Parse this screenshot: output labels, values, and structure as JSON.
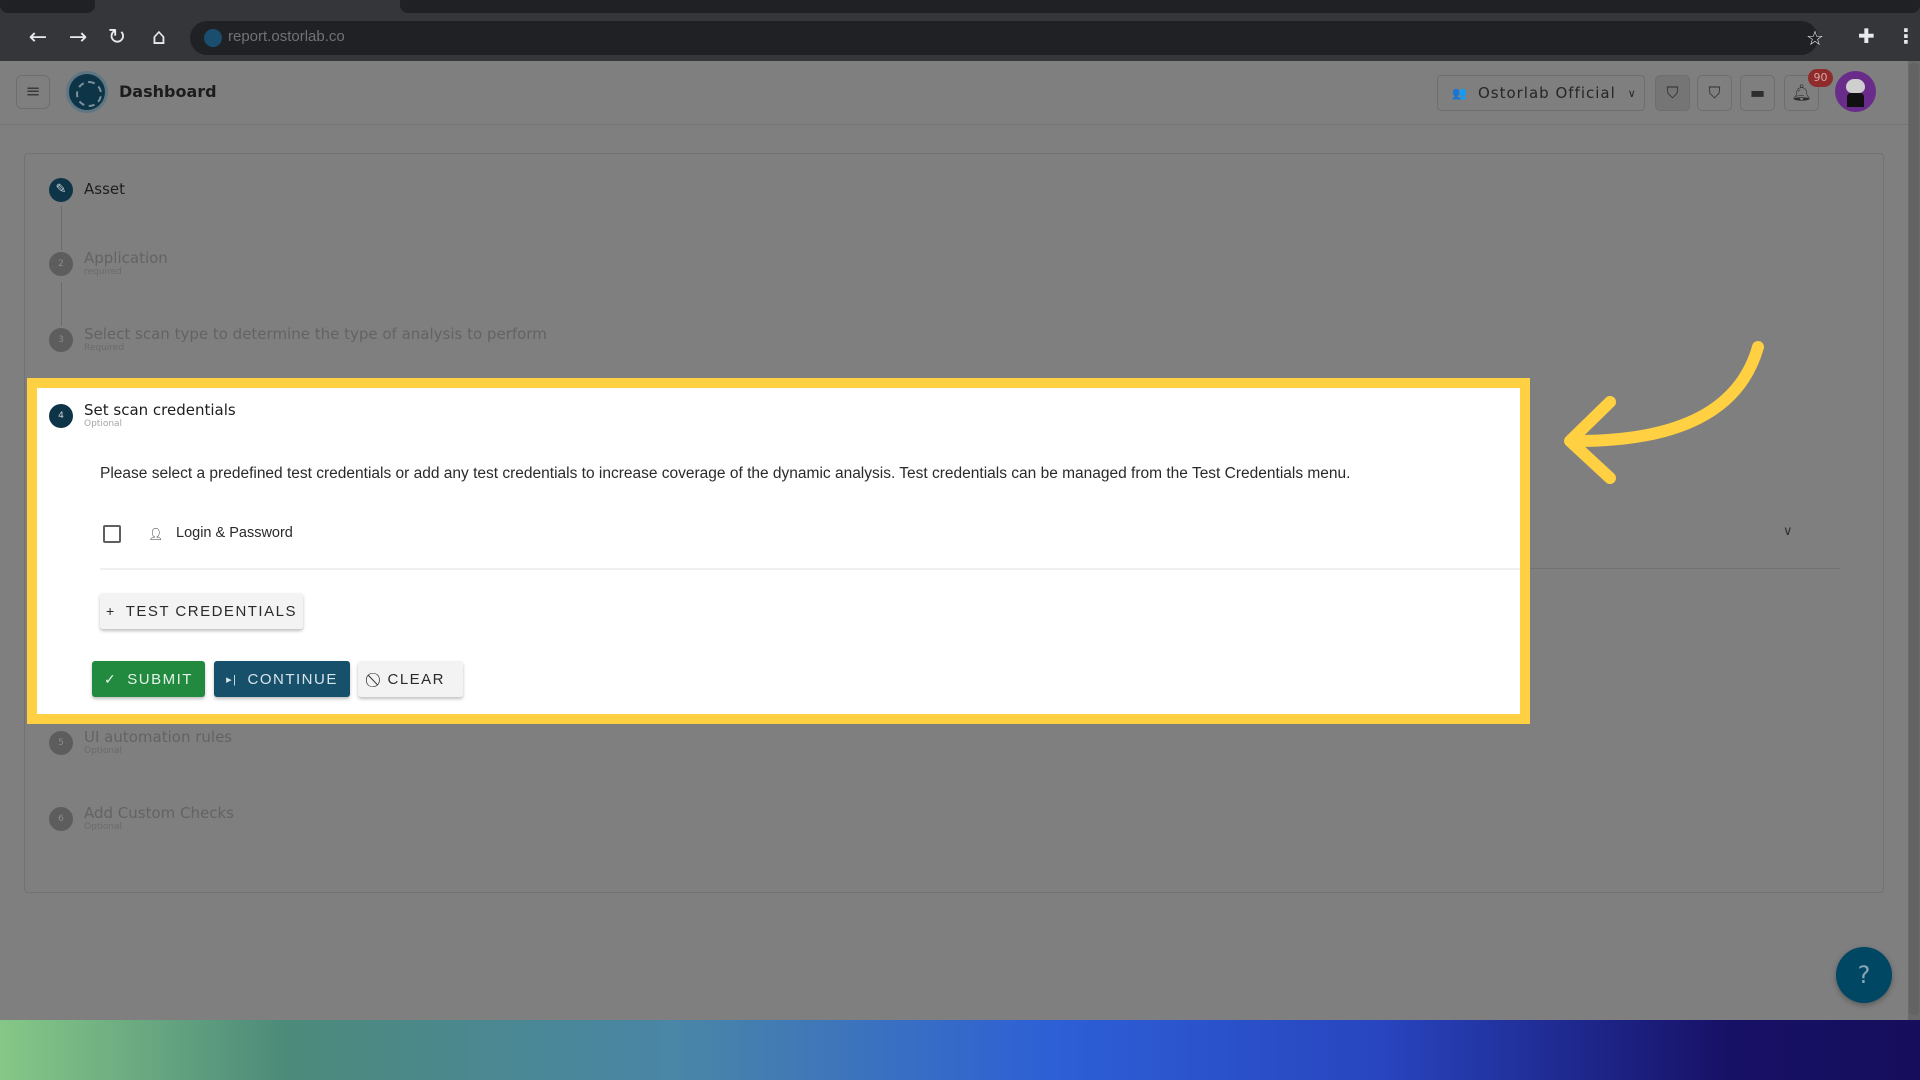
{
  "browser": {
    "url": "report.ostorlab.co",
    "icons": {
      "back": "arrow-left-icon",
      "forward": "arrow-right-icon",
      "reload": "reload-icon",
      "home": "home-icon",
      "bookmark": "star-icon",
      "extensions": "puzzle-icon",
      "menu": "kebab-menu-icon"
    }
  },
  "header": {
    "title": "Dashboard",
    "organization": "Ostorlab Official",
    "notification_count": "90"
  },
  "stepper": {
    "steps": [
      {
        "number": "1",
        "label": "Asset",
        "sublabel": "",
        "state": "edit"
      },
      {
        "number": "2",
        "label": "Application",
        "sublabel": "required",
        "state": "pending"
      },
      {
        "number": "3",
        "label": "Select scan type to determine the type of analysis to perform",
        "sublabel": "Required",
        "state": "pending"
      },
      {
        "number": "4",
        "label": "Set scan credentials",
        "sublabel": "Optional",
        "state": "active"
      },
      {
        "number": "5",
        "label": "UI automation rules",
        "sublabel": "Optional",
        "state": "pending"
      },
      {
        "number": "6",
        "label": "Add Custom Checks",
        "sublabel": "Optional",
        "state": "pending"
      }
    ]
  },
  "credentials_step": {
    "description": "Please select a predefined test credentials or add any test credentials to increase coverage of the dynamic analysis. Test credentials can be managed from the Test Credentials menu.",
    "items": [
      {
        "label": "Login & Password",
        "checked": false
      }
    ],
    "add_button": "TEST CREDENTIALS",
    "actions": {
      "submit": "SUBMIT",
      "continue": "CONTINUE",
      "clear": "CLEAR"
    }
  },
  "help": {
    "label": "?"
  },
  "colors": {
    "highlight": "#fed042",
    "primary": "#0d3547",
    "submit": "#218a3f",
    "continue": "#17506b",
    "badge": "#8f2b2b"
  }
}
